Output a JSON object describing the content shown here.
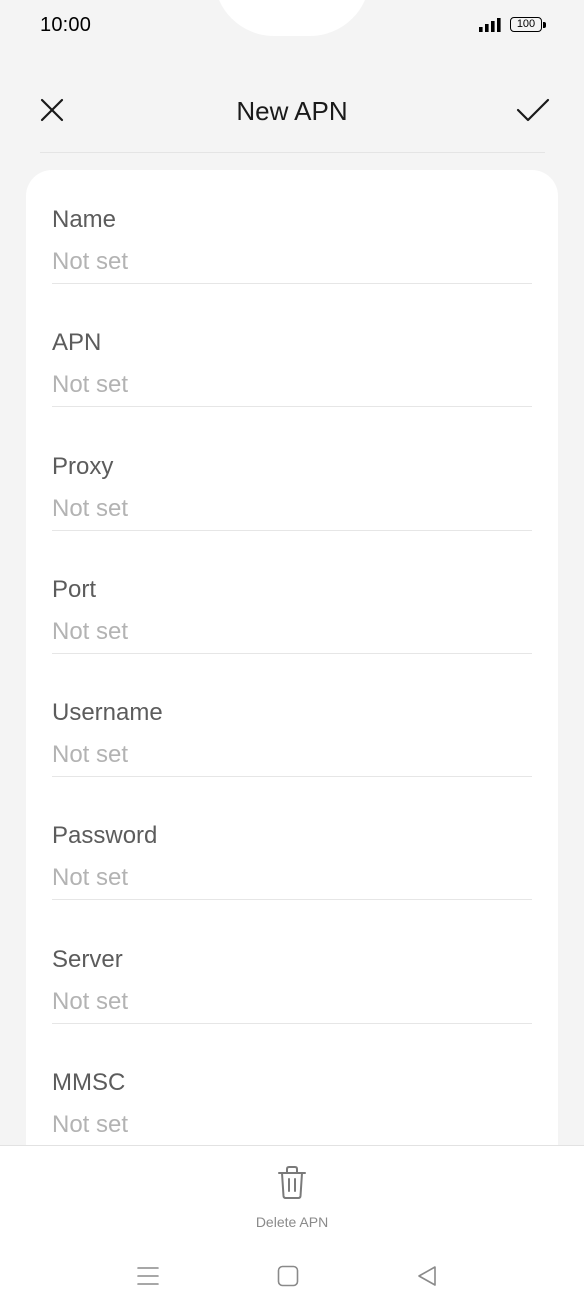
{
  "status_bar": {
    "time": "10:00",
    "battery_level": "100",
    "signal_icon": "signal-bars-icon"
  },
  "app_bar": {
    "title": "New APN",
    "close_icon": "close-icon",
    "confirm_icon": "checkmark-icon"
  },
  "fields": [
    {
      "label": "Name",
      "value": "Not set"
    },
    {
      "label": "APN",
      "value": "Not set"
    },
    {
      "label": "Proxy",
      "value": "Not set"
    },
    {
      "label": "Port",
      "value": "Not set"
    },
    {
      "label": "Username",
      "value": "Not set"
    },
    {
      "label": "Password",
      "value": "Not set"
    },
    {
      "label": "Server",
      "value": "Not set"
    },
    {
      "label": "MMSC",
      "value": "Not set"
    }
  ],
  "bottom_action": {
    "label": "Delete APN",
    "icon": "trash-icon"
  },
  "nav_bar": {
    "menu_icon": "menu-icon",
    "home_icon": "home-icon",
    "back_icon": "back-icon"
  },
  "colors": {
    "background": "#f4f4f4",
    "card": "#ffffff",
    "label": "#5c5c5c",
    "placeholder": "#b3b3b3",
    "title": "#1a1a1a"
  }
}
